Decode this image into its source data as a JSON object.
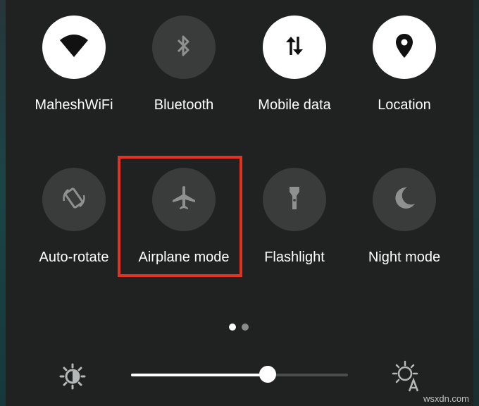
{
  "tiles": [
    {
      "label": "MaheshWiFi",
      "icon": "wifi-icon",
      "active": true
    },
    {
      "label": "Bluetooth",
      "icon": "bluetooth-icon",
      "active": false
    },
    {
      "label": "Mobile data",
      "icon": "mobile-data-icon",
      "active": true
    },
    {
      "label": "Location",
      "icon": "location-pin-icon",
      "active": true
    },
    {
      "label": "Auto-rotate",
      "icon": "auto-rotate-icon",
      "active": false
    },
    {
      "label": "Airplane mode",
      "icon": "airplane-icon",
      "active": false,
      "highlighted": true
    },
    {
      "label": "Flashlight",
      "icon": "flashlight-icon",
      "active": false
    },
    {
      "label": "Night mode",
      "icon": "night-mode-icon",
      "active": false
    }
  ],
  "pager": {
    "pages": 2,
    "current": 1
  },
  "brightness": {
    "level": 0.63,
    "low_icon": "brightness-low-icon",
    "auto_icon": "brightness-auto-icon"
  },
  "colors": {
    "active_tile": "#ffffff",
    "inactive_tile": "#3a3b3b",
    "highlight": "#e5321d"
  },
  "watermark": "wsxdn.com"
}
